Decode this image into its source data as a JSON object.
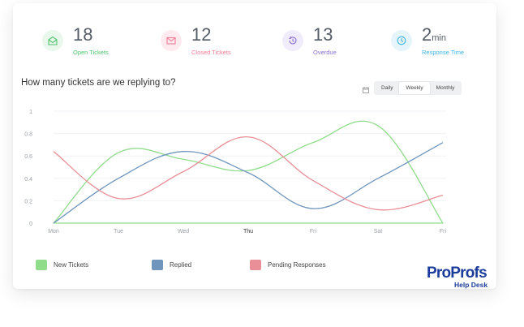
{
  "stats": [
    {
      "number": "18",
      "unit": "",
      "label": "Open Tickets",
      "color": "#4fc46a",
      "bg": "#e9f7ec",
      "icon": "envelope-open-icon"
    },
    {
      "number": "12",
      "unit": "",
      "label": "Closed Tickets",
      "color": "#ef7c95",
      "bg": "#fdebef",
      "icon": "envelope-closed-icon"
    },
    {
      "number": "13",
      "unit": "",
      "label": "Overdue",
      "color": "#8a6fd6",
      "bg": "#f0ecfb",
      "icon": "history-icon"
    },
    {
      "number": "2",
      "unit": "min",
      "label": "Response Time",
      "color": "#3db4e8",
      "bg": "#e6f5fc",
      "icon": "clock-icon"
    }
  ],
  "panel": {
    "question": "How many tickets are we replying to?",
    "range_options": [
      "Daily",
      "Weekly",
      "Monthly"
    ],
    "range_selected": "Weekly"
  },
  "chart_data": {
    "type": "line",
    "categories": [
      "Mon",
      "Tue",
      "Wed",
      "Thu",
      "Fri",
      "Sat",
      "Fri"
    ],
    "highlighted_category": "Thu",
    "y_ticks": [
      "1",
      "0.8",
      "0.6",
      "0.4",
      "0.2",
      "0"
    ],
    "ylim": [
      0,
      1
    ],
    "grid": true,
    "legend_position": "bottom",
    "series": [
      {
        "name": "New Tickets",
        "color": "#8fdc8a",
        "values": [
          0,
          0.63,
          0.57,
          0.47,
          0.72,
          0.87,
          0
        ]
      },
      {
        "name": "Replied",
        "color": "#6f95bd",
        "values": [
          0,
          0.4,
          0.64,
          0.45,
          0.13,
          0.4,
          0.72
        ]
      },
      {
        "name": "Pending Responses",
        "color": "#e98f97",
        "values": [
          0.64,
          0.22,
          0.46,
          0.77,
          0.38,
          0.12,
          0.25
        ]
      }
    ],
    "baseline": {
      "name": "New Tickets",
      "color": "#8fdc8a"
    }
  },
  "brand": {
    "name": "ProProfs",
    "sub": "Help Desk",
    "color": "#1c3c9b"
  }
}
